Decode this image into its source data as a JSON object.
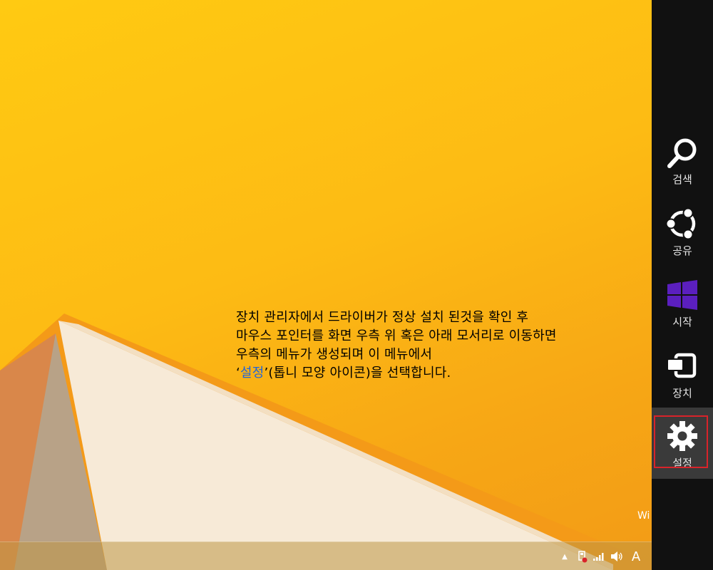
{
  "instruction": {
    "line1": "장치 관리자에서 드라이버가 정상 설치 된것을 확인 후",
    "line2": "마우스 포인터를 화면 우측 위 혹은 아래 모서리로 이동하면",
    "line3": "우측의 메뉴가 생성되며 이 메뉴에서",
    "line4_quote_open": "‘",
    "line4_highlight": "설정",
    "line4_rest": "’(톱니 모양 아이콘)을 선택합니다."
  },
  "watermark_text": "Wi",
  "charms": {
    "search": {
      "label": "검색",
      "icon": "magnifier-icon"
    },
    "share": {
      "label": "공유",
      "icon": "share-icon"
    },
    "start": {
      "label": "시작",
      "icon": "windows-logo-icon",
      "color": "#5b1fbf"
    },
    "devices": {
      "label": "장치",
      "icon": "devices-icon"
    },
    "settings": {
      "label": "설정",
      "icon": "gear-icon",
      "highlight_color": "#d9232a"
    }
  },
  "tray": {
    "up_arrow": "▲",
    "ime": "A"
  },
  "colors": {
    "wallpaper": "#fdbb14",
    "charms_bg": "#111111",
    "highlight_text": "#1e64dc"
  }
}
